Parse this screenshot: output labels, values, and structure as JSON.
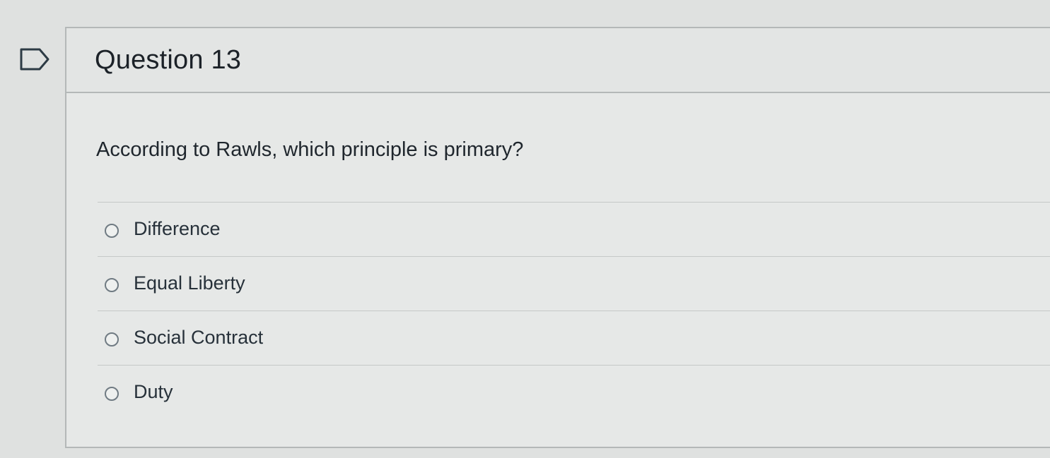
{
  "question": {
    "title": "Question 13",
    "text": "According to Rawls, which principle is primary?",
    "flag_icon": "flag-outline-icon",
    "options": [
      {
        "label": "Difference",
        "selected": false
      },
      {
        "label": "Equal Liberty",
        "selected": false
      },
      {
        "label": "Social Contract",
        "selected": false
      },
      {
        "label": "Duty",
        "selected": false
      }
    ]
  },
  "colors": {
    "background": "#dfe1e0",
    "border": "#b4b8b8",
    "text": "#1f262d"
  }
}
